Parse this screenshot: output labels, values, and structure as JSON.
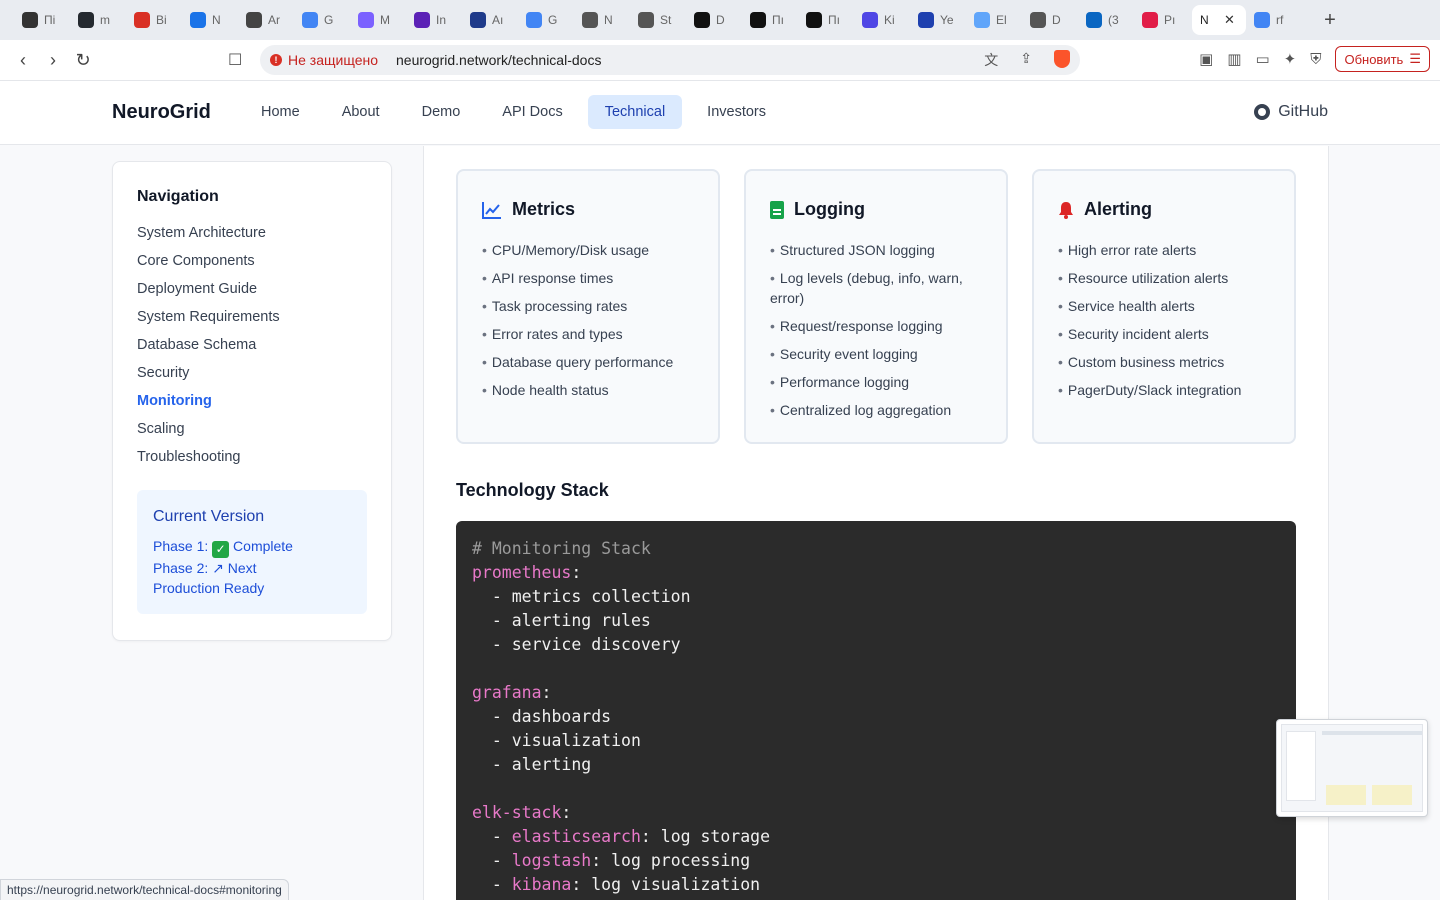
{
  "browser": {
    "tabs": [
      {
        "title": "Пі",
        "color": "#333333",
        "icon": "copilot-icon"
      },
      {
        "title": "m",
        "color": "#24292f",
        "icon": "github-icon"
      },
      {
        "title": "Bi",
        "color": "#d93025",
        "icon": "gmail-icon"
      },
      {
        "title": "N",
        "color": "#1a73e8",
        "icon": "drive-icon"
      },
      {
        "title": "Ar",
        "color": "#444444",
        "icon": "app-icon"
      },
      {
        "title": "G",
        "color": "#4285f4",
        "icon": "translate-icon"
      },
      {
        "title": "M",
        "color": "#7b61ff",
        "icon": "copilot-color-icon"
      },
      {
        "title": "In",
        "color": "#5b21b6",
        "icon": "play-icon"
      },
      {
        "title": "Aı",
        "color": "#1e3a8a",
        "icon": "circle-icon"
      },
      {
        "title": "G",
        "color": "#4285f4",
        "icon": "gemini-icon"
      },
      {
        "title": "N",
        "color": "#555555",
        "icon": "globe-icon"
      },
      {
        "title": "St",
        "color": "#555555",
        "icon": "globe-icon"
      },
      {
        "title": "D",
        "color": "#111111",
        "icon": "dark-circle-icon"
      },
      {
        "title": "Пı",
        "color": "#111111",
        "icon": "h-icon"
      },
      {
        "title": "Пı",
        "color": "#111111",
        "icon": "h-icon"
      },
      {
        "title": "Ki",
        "color": "#4f46e5",
        "icon": "wave-icon"
      },
      {
        "title": "Ye",
        "color": "#1e40af",
        "icon": "grid-icon"
      },
      {
        "title": "El",
        "color": "#60a5fa",
        "icon": "doc-icon"
      },
      {
        "title": "D",
        "color": "#555555",
        "icon": "globe-icon"
      },
      {
        "title": "(3",
        "color": "#0a66c2",
        "icon": "linkedin-icon"
      },
      {
        "title": "Pı",
        "color": "#e11d48",
        "icon": "p-icon"
      }
    ],
    "active_tab": {
      "title": "N",
      "icon": "neurogrid-icon"
    },
    "last_tab": {
      "title": "rf",
      "color": "#4285f4",
      "icon": "google-icon"
    },
    "new_tab": "+",
    "insecure_label": "Не защищено",
    "url": "neurogrid.network/technical-docs",
    "update_label": "Обновить",
    "status_url": "https://neurogrid.network/technical-docs#monitoring"
  },
  "site": {
    "logo": "NeuroGrid",
    "nav": [
      {
        "label": "Home",
        "active": false
      },
      {
        "label": "About",
        "active": false
      },
      {
        "label": "Demo",
        "active": false
      },
      {
        "label": "API Docs",
        "active": false
      },
      {
        "label": "Technical",
        "active": true
      },
      {
        "label": "Investors",
        "active": false
      }
    ],
    "github": "GitHub"
  },
  "sidebar": {
    "title": "Navigation",
    "links": [
      {
        "label": "System Architecture",
        "active": false
      },
      {
        "label": "Core Components",
        "active": false
      },
      {
        "label": "Deployment Guide",
        "active": false
      },
      {
        "label": "System Requirements",
        "active": false
      },
      {
        "label": "Database Schema",
        "active": false
      },
      {
        "label": "Security",
        "active": false
      },
      {
        "label": "Monitoring",
        "active": true
      },
      {
        "label": "Scaling",
        "active": false
      },
      {
        "label": "Troubleshooting",
        "active": false
      }
    ],
    "version": {
      "title": "Current Version",
      "phase1_label": "Phase 1:",
      "phase1_status": "Complete",
      "phase2_label": "Phase 2:",
      "phase2_status": "Next",
      "production": "Production Ready"
    }
  },
  "cards": [
    {
      "title": "Metrics",
      "icon": "chart-line-icon",
      "color": "#2563eb",
      "items": [
        "CPU/Memory/Disk usage",
        "API response times",
        "Task processing rates",
        "Error rates and types",
        "Database query performance",
        "Node health status"
      ]
    },
    {
      "title": "Logging",
      "icon": "document-icon",
      "color": "#16a34a",
      "items": [
        "Structured JSON logging",
        "Log levels (debug, info, warn, error)",
        "Request/response logging",
        "Security event logging",
        "Performance logging",
        "Centralized log aggregation"
      ]
    },
    {
      "title": "Alerting",
      "icon": "bell-icon",
      "color": "#dc2626",
      "items": [
        "High error rate alerts",
        "Resource utilization alerts",
        "Service health alerts",
        "Security incident alerts",
        "Custom business metrics",
        "PagerDuty/Slack integration"
      ]
    }
  ],
  "stack": {
    "title": "Technology Stack",
    "code": [
      {
        "kind": "comment",
        "text": "# Monitoring Stack"
      },
      {
        "kind": "key",
        "key": "prometheus",
        "rest": ":"
      },
      {
        "kind": "item",
        "text": "  - metrics collection"
      },
      {
        "kind": "item",
        "text": "  - alerting rules"
      },
      {
        "kind": "item",
        "text": "  - service discovery"
      },
      {
        "kind": "blank",
        "text": ""
      },
      {
        "kind": "key",
        "key": "grafana",
        "rest": ":"
      },
      {
        "kind": "item",
        "text": "  - dashboards"
      },
      {
        "kind": "item",
        "text": "  - visualization"
      },
      {
        "kind": "item",
        "text": "  - alerting"
      },
      {
        "kind": "blank",
        "text": ""
      },
      {
        "kind": "key",
        "key": "elk-stack",
        "rest": ":"
      },
      {
        "kind": "subkey",
        "prefix": "  - ",
        "key": "elasticsearch",
        "rest": ": log storage"
      },
      {
        "kind": "subkey",
        "prefix": "  - ",
        "key": "logstash",
        "rest": ": log processing"
      },
      {
        "kind": "subkey",
        "prefix": "  - ",
        "key": "kibana",
        "rest": ": log visualization"
      }
    ]
  }
}
